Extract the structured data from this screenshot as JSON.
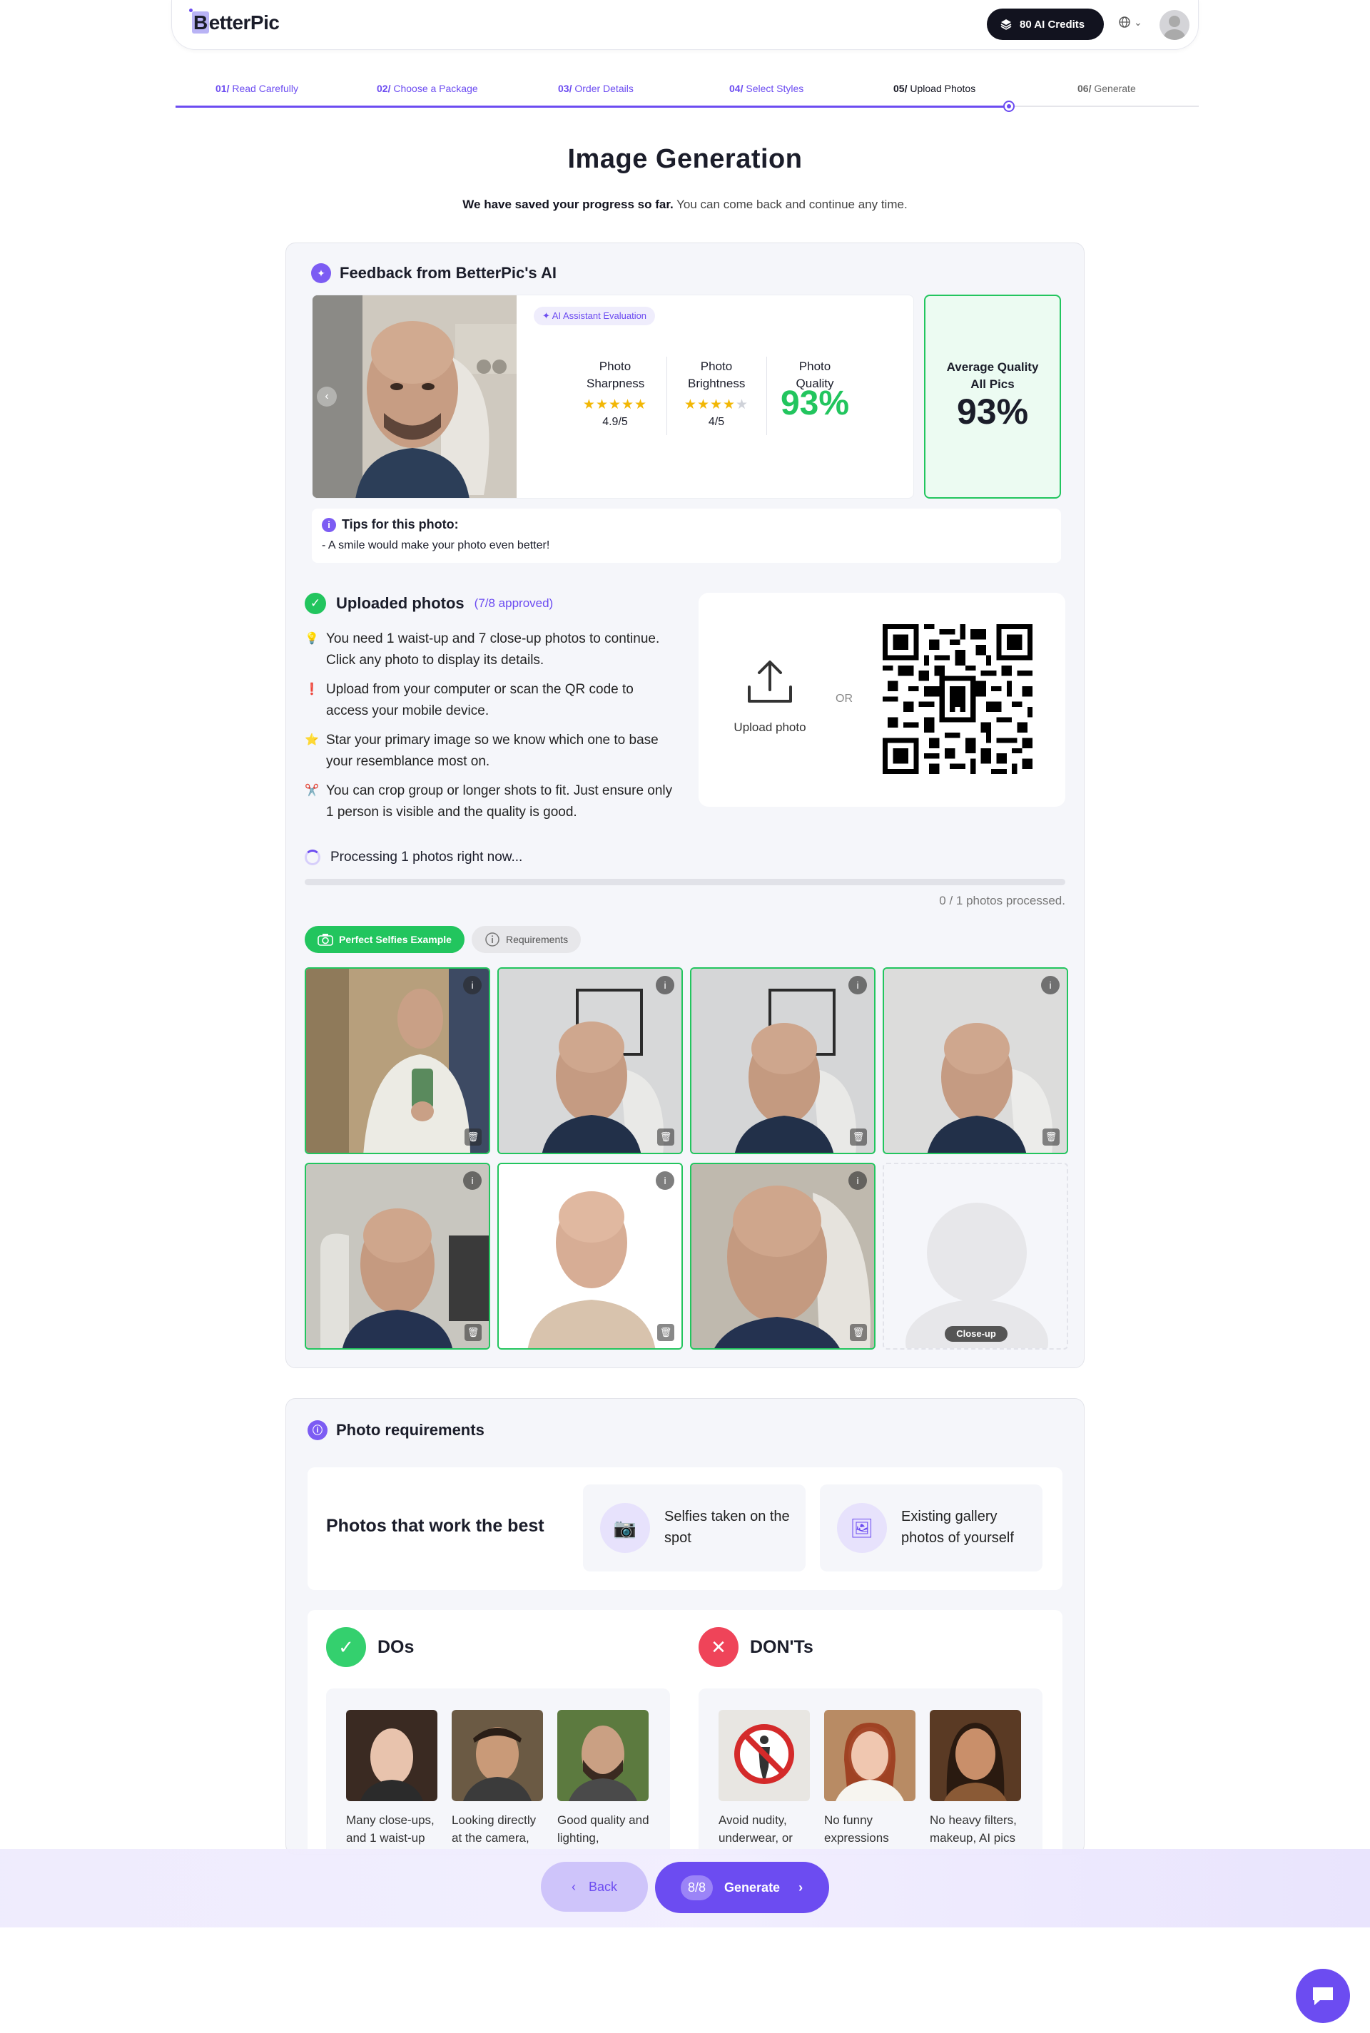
{
  "header": {
    "logo": "BetterPic",
    "credits": "80 AI Credits"
  },
  "steps": [
    {
      "num": "01/",
      "label": "Read Carefully"
    },
    {
      "num": "02/",
      "label": "Choose a Package"
    },
    {
      "num": "03/",
      "label": "Order Details"
    },
    {
      "num": "04/",
      "label": "Select Styles"
    },
    {
      "num": "05/",
      "label": "Upload Photos"
    },
    {
      "num": "06/",
      "label": "Generate"
    }
  ],
  "page": {
    "title": "Image Generation",
    "subtitle_bold": "We have saved your progress so far.",
    "subtitle_rest": " You can come back and continue any time."
  },
  "feedback": {
    "heading": "Feedback from BetterPic's AI",
    "tag": "AI Assistant Evaluation",
    "sharpness_label": "Photo Sharpness",
    "sharpness_value": "4.9/5",
    "brightness_label": "Photo Brightness",
    "brightness_value": "4/5",
    "quality_label": "Photo Quality",
    "quality_value": "93%",
    "avg_label_1": "Average Quality",
    "avg_label_2": "All Pics",
    "avg_value": "93%",
    "tips_heading": "Tips for this photo:",
    "tips_text": "- A smile would make your photo even better!"
  },
  "uploaded": {
    "heading": "Uploaded photos",
    "approved": "(7/8 approved)",
    "bullets": [
      "You need 1 waist-up and 7 close-up photos to continue. Click any photo to display its details.",
      "Upload from your computer or scan the QR code to access your mobile device.",
      "Star your primary image so we know which one to base your resemblance most on.",
      "You can crop group or longer shots to fit. Just ensure only 1 person is visible and the quality is good."
    ],
    "upload_label": "Upload photo",
    "or": "OR",
    "processing": "Processing 1 photos right now...",
    "processed": "0 / 1 photos processed.",
    "tab_examples": "Perfect Selfies Example",
    "tab_requirements": "Requirements",
    "placeholder_label": "Close-up"
  },
  "requirements": {
    "heading": "Photo requirements",
    "works_best": "Photos that work the best",
    "card1": "Selfies taken on the spot",
    "card2": "Existing gallery photos of yourself",
    "dos": "DOs",
    "donts": "DON'Ts",
    "do_caps": [
      "Many close-ups, and 1 waist-up",
      "Looking directly at the camera,",
      "Good quality and lighting,"
    ],
    "dont_caps": [
      "Avoid nudity, underwear, or",
      "No funny expressions",
      "No heavy filters, makeup, AI pics"
    ]
  },
  "footer": {
    "back": "Back",
    "count": "8/8",
    "generate": "Generate"
  }
}
